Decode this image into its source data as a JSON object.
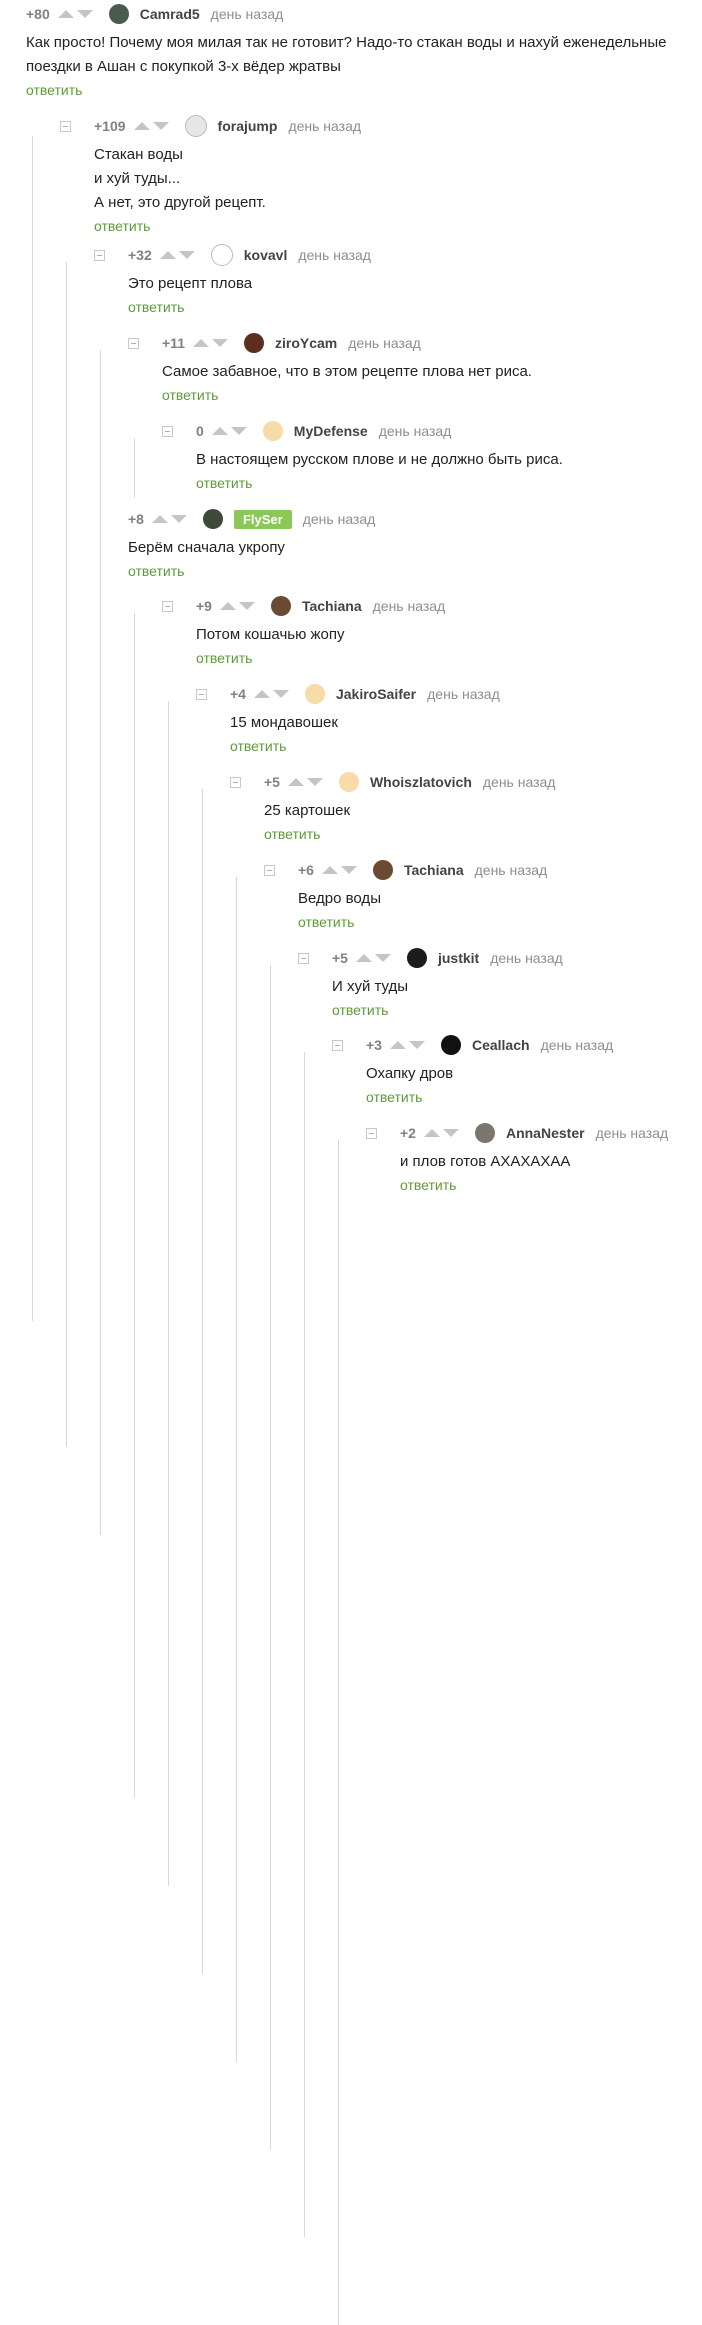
{
  "comments": [
    {
      "rating": "+80",
      "user": "Camrad5",
      "date": "день назад",
      "text": "Как просто! Почему моя милая так не готовит? Надо-то стакан воды и нахуй еженедельные\nпоездки в Ашан с покупкой 3-х вёдер жратвы",
      "reply": "ответить",
      "avatar": "avatar-photo",
      "color": "#4a5a4e"
    },
    {
      "rating": "+109",
      "user": "forajump",
      "date": "день назад",
      "text": "Стакан воды\nи хуй туды...\nА нет, это другой рецепт.",
      "reply": "ответить",
      "avatar": "socket-icon",
      "color": "#e6e6e6"
    },
    {
      "rating": "+32",
      "user": "kovavl",
      "date": "день назад",
      "text": "Это рецепт плова",
      "reply": "ответить",
      "avatar": "sketch-face-icon",
      "color": "#ffffff"
    },
    {
      "rating": "+11",
      "user": "ziroYcam",
      "date": "день назад",
      "text": "Самое забавное, что в этом рецепте плова нет риса.",
      "reply": "ответить",
      "avatar": "avatar-photo",
      "color": "#5b2e20"
    },
    {
      "rating": "0",
      "user": "MyDefense",
      "date": "день назад",
      "text": "В настоящем русском плове и не должно быть риса.",
      "reply": "ответить",
      "avatar": "default-avatar-icon",
      "color": "#f7dba8"
    },
    {
      "rating": "+8",
      "user": "FlySer",
      "date": "день назад",
      "text": "Берём сначала укропу",
      "reply": "ответить",
      "avatar": "avatar-photo",
      "color": "#3d4a3a"
    },
    {
      "rating": "+9",
      "user": "Tachiana",
      "date": "день назад",
      "text": "Потом кошачью жопу",
      "reply": "ответить",
      "avatar": "avatar-photo",
      "color": "#6b4a33"
    },
    {
      "rating": "+4",
      "user": "JakiroSaifer",
      "date": "день назад",
      "text": "15 мондавошек",
      "reply": "ответить",
      "avatar": "default-avatar-icon",
      "color": "#f7dba8"
    },
    {
      "rating": "+5",
      "user": "Whoiszlatovich",
      "date": "день назад",
      "text": "25 картошек",
      "reply": "ответить",
      "avatar": "default-avatar-icon",
      "color": "#f7dba8"
    },
    {
      "rating": "+6",
      "user": "Tachiana",
      "date": "день назад",
      "text": "Ведро воды",
      "reply": "ответить",
      "avatar": "avatar-photo",
      "color": "#6b4a33"
    },
    {
      "rating": "+5",
      "user": "justkit",
      "date": "день назад",
      "text": "И хуй туды",
      "reply": "ответить",
      "avatar": "avatar-photo",
      "color": "#1c1c1c"
    },
    {
      "rating": "+3",
      "user": "Ceallach",
      "date": "день назад",
      "text": "Охапку дров",
      "reply": "ответить",
      "avatar": "avatar-photo",
      "color": "#111111"
    },
    {
      "rating": "+2",
      "user": "AnnaNester",
      "date": "день назад",
      "text": "и плов готов АХАХАХАА",
      "reply": "ответить",
      "avatar": "avatar-photo",
      "color": "#7d766c"
    }
  ]
}
